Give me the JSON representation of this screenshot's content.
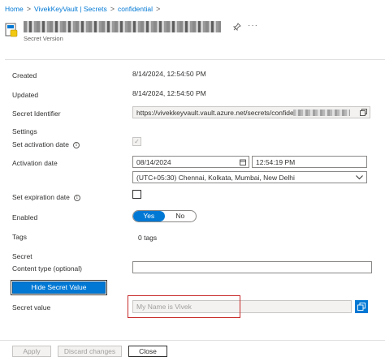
{
  "breadcrumb": {
    "items": [
      "Home",
      "VivekKeyVault | Secrets",
      "confidential"
    ],
    "separator": ">"
  },
  "header": {
    "subtitle": "Secret Version",
    "pin_icon": "pin-icon",
    "more_icon": "more-icon",
    "more_glyph": "···"
  },
  "fields": {
    "created_label": "Created",
    "created_value": "8/14/2024, 12:54:50 PM",
    "updated_label": "Updated",
    "updated_value": "8/14/2024, 12:54:50 PM",
    "secret_identifier_label": "Secret Identifier",
    "secret_identifier_value": "https://vivekkeyvault.vault.azure.net/secrets/confidential/",
    "settings_label": "Settings",
    "set_activation_label": "Set activation date",
    "activation_date_label": "Activation date",
    "activation_date_value": "08/14/2024",
    "activation_time_value": "12:54:19 PM",
    "timezone_value": "(UTC+05:30) Chennai, Kolkata, Mumbai, New Delhi",
    "set_expiration_label": "Set expiration date",
    "enabled_label": "Enabled",
    "enabled_yes": "Yes",
    "enabled_no": "No",
    "tags_label": "Tags",
    "tags_value": "0 tags",
    "secret_label": "Secret",
    "content_type_label": "Content type (optional)",
    "content_type_value": "",
    "hide_secret_button": "Hide Secret Value",
    "secret_value_label": "Secret value",
    "secret_value": "My Name is Vivek"
  },
  "footer": {
    "apply": "Apply",
    "discard": "Discard changes",
    "close": "Close"
  },
  "colors": {
    "accent": "#0078d4",
    "highlight_border": "#c82a2a"
  }
}
